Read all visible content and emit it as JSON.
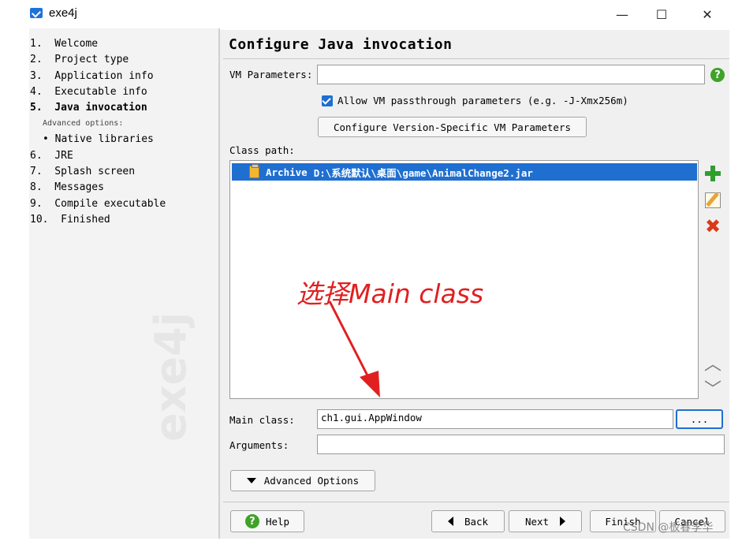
{
  "window": {
    "title": "exe4j",
    "minimize_glyph": "—",
    "maximize_glyph": "☐",
    "close_glyph": "✕"
  },
  "sidebar": {
    "steps": [
      {
        "label": "1.  Welcome",
        "active": false
      },
      {
        "label": "2.  Project type",
        "active": false
      },
      {
        "label": "3.  Application info",
        "active": false
      },
      {
        "label": "4.  Executable info",
        "active": false
      },
      {
        "label": "5.  Java invocation",
        "active": true
      }
    ],
    "advanced_label": "Advanced options:",
    "sub_items": [
      {
        "label": "• Native libraries"
      }
    ],
    "steps_after": [
      {
        "label": "6.  JRE"
      },
      {
        "label": "7.  Splash screen"
      },
      {
        "label": "8.  Messages"
      },
      {
        "label": "9.  Compile executable"
      },
      {
        "label": "10.  Finished"
      }
    ],
    "watermark": "exe4j"
  },
  "main": {
    "title": "Configure Java invocation",
    "vm_parameters": {
      "label": "VM Parameters:",
      "value": ""
    },
    "allow_passthrough": {
      "checked": true,
      "label": "Allow VM passthrough parameters (e.g. -J-Xmx256m)"
    },
    "configure_vm_button": "Configure Version-Specific VM Parameters",
    "class_path": {
      "label": "Class path:",
      "entries": [
        {
          "type": "Archive",
          "path": "D:\\系统默认\\桌面\\game\\AnimalChange2.jar",
          "selected": true
        }
      ]
    },
    "main_class": {
      "label": "Main class:",
      "value": "ch1.gui.AppWindow",
      "browse_label": "..."
    },
    "arguments": {
      "label": "Arguments:",
      "value": ""
    },
    "advanced_options_button": "Advanced Options"
  },
  "annotation": {
    "text": "选择Main class",
    "color": "#e02020"
  },
  "footer": {
    "help": "Help",
    "back": "Back",
    "next": "Next",
    "finish": "Finish",
    "cancel": "Cancel"
  },
  "watermark_credit": "CSDN @板春李华",
  "colors": {
    "accent": "#1f6fd1",
    "help_green": "#3fa229",
    "remove_red": "#d93a1a"
  }
}
